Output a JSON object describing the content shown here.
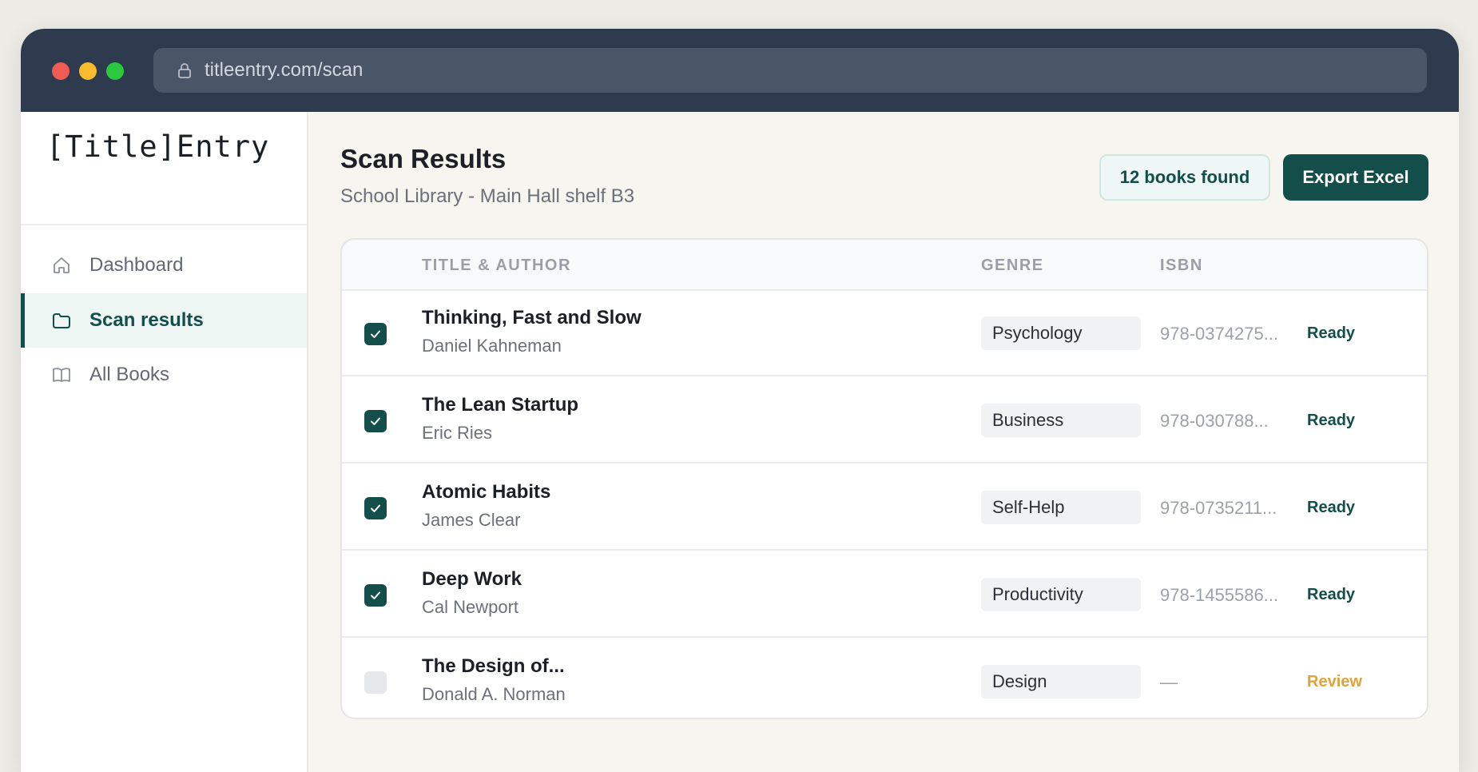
{
  "browser": {
    "url": "titleentry.com/scan"
  },
  "sidebar": {
    "logo": "[Title]Entry",
    "items": [
      {
        "label": "Dashboard",
        "icon": "home-icon"
      },
      {
        "label": "Scan results",
        "icon": "folder-icon",
        "active": true
      },
      {
        "label": "All Books",
        "icon": "book-open-icon"
      }
    ]
  },
  "main": {
    "title": "Scan Results",
    "subtitle": "School Library - Main Hall shelf B3",
    "count_badge": "12 books found",
    "export_label": "Export Excel"
  },
  "table": {
    "headers": {
      "title": "TITLE & AUTHOR",
      "genre": "GENRE",
      "isbn": "ISBN"
    },
    "rows": [
      {
        "checked": true,
        "title": "Thinking, Fast and Slow",
        "author": "Daniel Kahneman",
        "genre": "Psychology",
        "isbn": "978-0374275...",
        "status": "Ready"
      },
      {
        "checked": true,
        "title": "The Lean Startup",
        "author": "Eric Ries",
        "genre": "Business",
        "isbn": "978-030788...",
        "status": "Ready"
      },
      {
        "checked": true,
        "title": "Atomic Habits",
        "author": "James Clear",
        "genre": "Self-Help",
        "isbn": "978-0735211...",
        "status": "Ready"
      },
      {
        "checked": true,
        "title": "Deep Work",
        "author": "Cal Newport",
        "genre": "Productivity",
        "isbn": "978-1455586...",
        "status": "Ready"
      },
      {
        "checked": false,
        "title": "The Design of...",
        "author": "Donald A. Norman",
        "genre": "Design",
        "isbn": "—",
        "status": "Review"
      }
    ]
  },
  "colors": {
    "accent": "#134e4a",
    "review": "#e0a23a",
    "titlebar": "#2e3a4d"
  }
}
